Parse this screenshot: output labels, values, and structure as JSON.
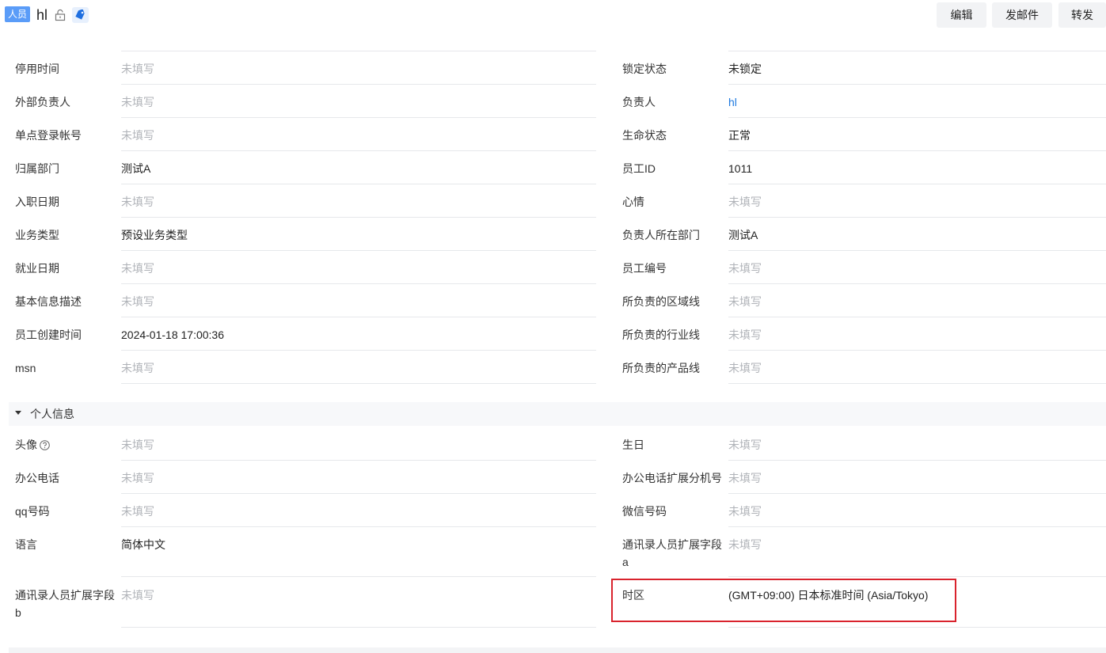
{
  "header": {
    "tag": "人员",
    "title": "hl",
    "buttons": {
      "edit": "编辑",
      "mail": "发邮件",
      "forward": "转发"
    }
  },
  "partial_top": {
    "left_label": "停     ",
    "right_label": "    "
  },
  "left_fields": [
    {
      "label": "停用时间",
      "value": "未填写",
      "empty": true
    },
    {
      "label": "外部负责人",
      "value": "未填写",
      "empty": true
    },
    {
      "label": "单点登录帐号",
      "value": "未填写",
      "empty": true
    },
    {
      "label": "归属部门",
      "value": "测试A",
      "empty": false
    },
    {
      "label": "入职日期",
      "value": "未填写",
      "empty": true
    },
    {
      "label": "业务类型",
      "value": "预设业务类型",
      "empty": false
    },
    {
      "label": "就业日期",
      "value": "未填写",
      "empty": true
    },
    {
      "label": "基本信息描述",
      "value": "未填写",
      "empty": true
    },
    {
      "label": "员工创建时间",
      "value": "2024-01-18 17:00:36",
      "empty": false
    },
    {
      "label": "msn",
      "value": "未填写",
      "empty": true
    }
  ],
  "right_fields": [
    {
      "label": "锁定状态",
      "value": "未锁定",
      "empty": false
    },
    {
      "label": "负责人",
      "value": "hl",
      "empty": false,
      "link": true
    },
    {
      "label": "生命状态",
      "value": "正常",
      "empty": false
    },
    {
      "label": "员工ID",
      "value": "1011",
      "empty": false
    },
    {
      "label": "心情",
      "value": "未填写",
      "empty": true
    },
    {
      "label": "负责人所在部门",
      "value": "测试A",
      "empty": false
    },
    {
      "label": "员工编号",
      "value": "未填写",
      "empty": true
    },
    {
      "label": "所负责的区域线",
      "value": "未填写",
      "empty": true
    },
    {
      "label": "所负责的行业线",
      "value": "未填写",
      "empty": true
    },
    {
      "label": "所负责的产品线",
      "value": "未填写",
      "empty": true
    }
  ],
  "section": {
    "title": "个人信息"
  },
  "personal_left": [
    {
      "label": "头像",
      "value": "未填写",
      "empty": true,
      "help": true
    },
    {
      "label": "办公电话",
      "value": "未填写",
      "empty": true
    },
    {
      "label": "qq号码",
      "value": "未填写",
      "empty": true
    },
    {
      "label": "语言",
      "value": "简体中文",
      "empty": false
    },
    {
      "label": "通讯录人员扩展字段b",
      "value": "未填写",
      "empty": true
    }
  ],
  "personal_right": [
    {
      "label": "生日",
      "value": "未填写",
      "empty": true
    },
    {
      "label": "办公电话扩展分机号",
      "value": "未填写",
      "empty": true
    },
    {
      "label": "微信号码",
      "value": "未填写",
      "empty": true
    },
    {
      "label": "通讯录人员扩展字段a",
      "value": "未填写",
      "empty": true
    },
    {
      "label": "时区",
      "value": "(GMT+09:00) 日本标准时间 (Asia/Tokyo)",
      "empty": false
    }
  ],
  "colors": {
    "accent": "#1f7ae0",
    "tag_bg": "#5a9cf8",
    "highlight": "#d9232d",
    "placeholder": "#b0b3b8"
  }
}
